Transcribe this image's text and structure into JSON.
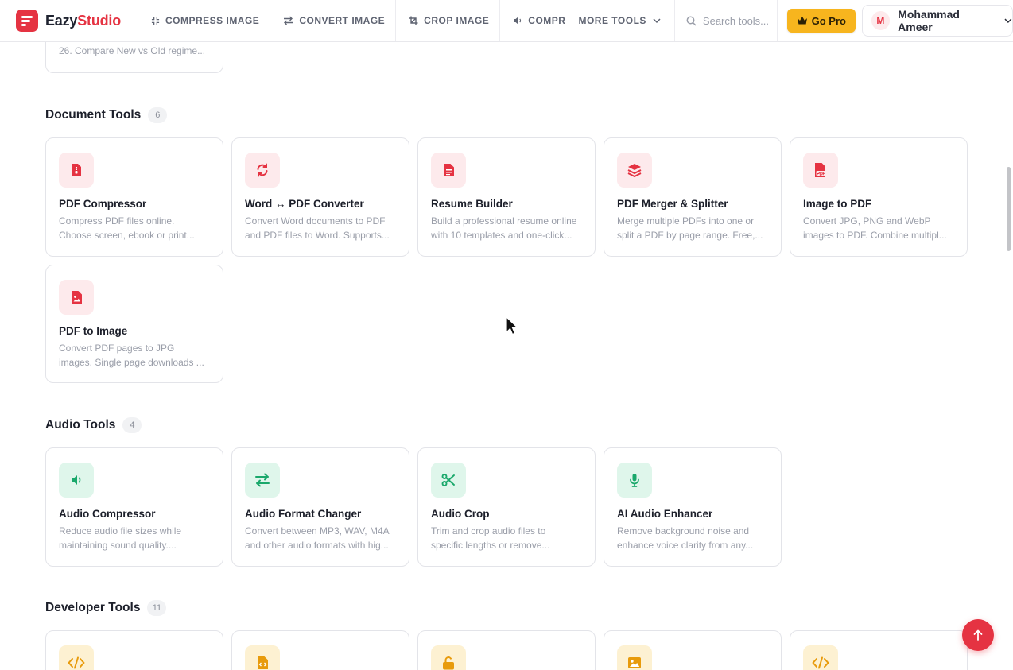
{
  "brand": {
    "name_part1": "Eazy",
    "name_part2": "Studio"
  },
  "nav": {
    "links": [
      "COMPRESS IMAGE",
      "CONVERT IMAGE",
      "CROP IMAGE",
      "COMPR"
    ],
    "more": "MORE TOOLS"
  },
  "search": {
    "placeholder": "Search tools..."
  },
  "gopro": {
    "label": "Go Pro"
  },
  "user": {
    "initial": "M",
    "name": "Mohammad Ameer"
  },
  "previous_card": {
    "desc": "26. Compare New vs Old regime..."
  },
  "sections": [
    {
      "title": "Document Tools",
      "count": "6",
      "tools": [
        {
          "icon": "pdf-compress-icon",
          "title": "PDF Compressor",
          "desc": [
            "Compress PDF files online.",
            "Choose screen, ebook or print..."
          ]
        },
        {
          "icon": "refresh-icon",
          "title": "Word ↔ PDF Converter",
          "desc": [
            "Convert Word documents to PDF",
            "and PDF files to Word. Supports..."
          ]
        },
        {
          "icon": "document-icon",
          "title": "Resume Builder",
          "desc": [
            "Build a professional resume online",
            "with 10 templates and one-click..."
          ]
        },
        {
          "icon": "layers-icon",
          "title": "PDF Merger & Splitter",
          "desc": [
            "Merge multiple PDFs into one or",
            "split a PDF by page range. Free,..."
          ]
        },
        {
          "icon": "pdf-file-icon",
          "title": "Image to PDF",
          "desc": [
            "Convert JPG, PNG and WebP",
            "images to PDF. Combine multipl..."
          ]
        },
        {
          "icon": "image-file-icon",
          "title": "PDF to Image",
          "desc": [
            "Convert PDF pages to JPG",
            "images. Single page downloads ..."
          ]
        }
      ]
    },
    {
      "title": "Audio Tools",
      "count": "4",
      "tools": [
        {
          "icon": "speaker-icon",
          "title": "Audio Compressor",
          "desc": [
            "Reduce audio file sizes while",
            "maintaining sound quality...."
          ]
        },
        {
          "icon": "swap-arrows-icon",
          "title": "Audio Format Changer",
          "desc": [
            "Convert between MP3, WAV, M4A",
            "and other audio formats with hig..."
          ]
        },
        {
          "icon": "scissors-icon",
          "title": "Audio Crop",
          "desc": [
            "Trim and crop audio files to",
            "specific lengths or remove..."
          ]
        },
        {
          "icon": "microphone-icon",
          "title": "AI Audio Enhancer",
          "desc": [
            "Remove background noise and",
            "enhance voice clarity from any..."
          ]
        }
      ]
    },
    {
      "title": "Developer Tools",
      "count": "11",
      "tools": [
        {
          "icon": "code-icon"
        },
        {
          "icon": "code-file-icon"
        },
        {
          "icon": "unlock-icon"
        },
        {
          "icon": "image-icon"
        },
        {
          "icon": "code-icon"
        }
      ]
    }
  ],
  "colors": {
    "brand_red": "#e53342",
    "gopro_yellow": "#f7b51e",
    "audio_green": "#1aa86b",
    "dev_amber": "#e89b0c"
  }
}
